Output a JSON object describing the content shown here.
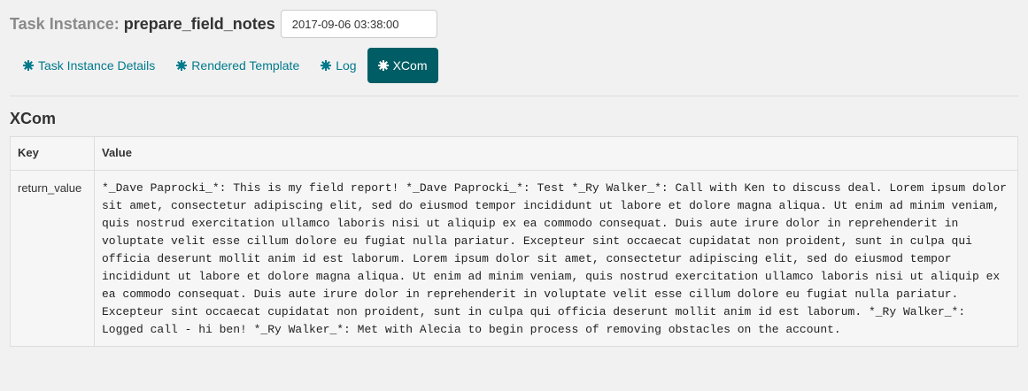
{
  "header": {
    "task_instance_label": "Task Instance:",
    "task_name": "prepare_field_notes",
    "execution_date": "2017-09-06 03:38:00"
  },
  "tabs": [
    {
      "label": "Task Instance Details",
      "icon": "gear-icon",
      "active": false
    },
    {
      "label": "Rendered Template",
      "icon": "gear-icon",
      "active": false
    },
    {
      "label": "Log",
      "icon": "gear-icon",
      "active": false
    },
    {
      "label": "XCom",
      "icon": "gear-icon",
      "active": true
    }
  ],
  "colors": {
    "accent": "#017a8c",
    "active_tab_bg": "#005d65"
  },
  "section": {
    "title": "XCom"
  },
  "table": {
    "headers": [
      "Key",
      "Value"
    ],
    "rows": [
      {
        "key": "return_value",
        "value": "*_Dave Paprocki_*: This is my field report! *_Dave Paprocki_*: Test *_Ry Walker_*: Call with Ken to discuss deal. Lorem ipsum dolor sit amet, consectetur adipiscing elit, sed do eiusmod tempor incididunt ut labore et dolore magna aliqua. Ut enim ad minim veniam, quis nostrud exercitation ullamco laboris nisi ut aliquip ex ea commodo consequat. Duis aute irure dolor in reprehenderit in voluptate velit esse cillum dolore eu fugiat nulla pariatur. Excepteur sint occaecat cupidatat non proident, sunt in culpa qui officia deserunt mollit anim id est laborum. Lorem ipsum dolor sit amet, consectetur adipiscing elit, sed do eiusmod tempor incididunt ut labore et dolore magna aliqua. Ut enim ad minim veniam, quis nostrud exercitation ullamco laboris nisi ut aliquip ex ea commodo consequat. Duis aute irure dolor in reprehenderit in voluptate velit esse cillum dolore eu fugiat nulla pariatur. Excepteur sint occaecat cupidatat non proident, sunt in culpa qui officia deserunt mollit anim id est laborum. *_Ry Walker_*: Logged call - hi ben! *_Ry Walker_*: Met with Alecia to begin process of removing obstacles on the account."
      }
    ]
  }
}
